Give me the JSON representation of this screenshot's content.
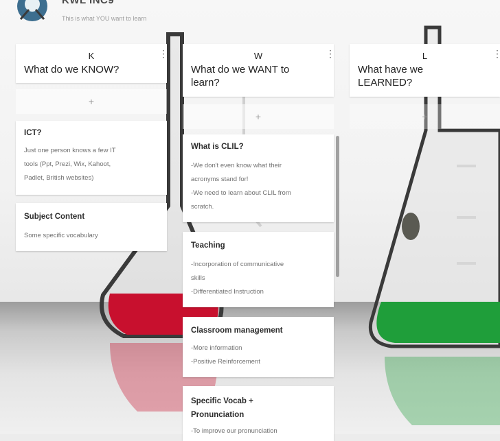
{
  "header": {
    "title": "KWL INC9",
    "subtitle": "This is what YOU want to learn"
  },
  "columns": [
    {
      "letter": "K",
      "title": "What do we KNOW?",
      "menu": "⋮",
      "add": "+",
      "cards": [
        {
          "title": "ICT?",
          "lines": [
            "Just one person knows a few IT",
            "tools (Ppt, Prezi, Wix, Kahoot,",
            "Padlet, British websites)"
          ]
        },
        {
          "title": "Subject Content",
          "lines": [
            "Some specific vocabulary"
          ]
        }
      ]
    },
    {
      "letter": "W",
      "title_lines": [
        "What do we WANT to",
        "learn?"
      ],
      "menu": "⋮",
      "add": "+",
      "cards": [
        {
          "title": "What is CLIL?",
          "lines": [
            "-We don't even know what their",
            "acronyms stand for!",
            "-We need to learn about CLIL from",
            "scratch."
          ]
        },
        {
          "title": "Teaching",
          "lines": [
            "-Incorporation of communicative",
            "skills",
            "-Differentiated Instruction"
          ]
        },
        {
          "title": "Classroom management",
          "lines": [
            "-More information",
            "-Positive Reinforcement"
          ]
        },
        {
          "title_lines": [
            "Specific Vocab +",
            "Pronunciation"
          ],
          "lines": [
            "-To improve our pronunciation"
          ]
        }
      ]
    },
    {
      "letter": "L",
      "title_lines": [
        "What have we",
        "LEARNED?"
      ],
      "menu": "⋮",
      "add": "+"
    }
  ],
  "colors": {
    "red_liquid": "#c8102e",
    "green_liquid": "#1f9e3a",
    "card_bg": "#ffffff"
  }
}
